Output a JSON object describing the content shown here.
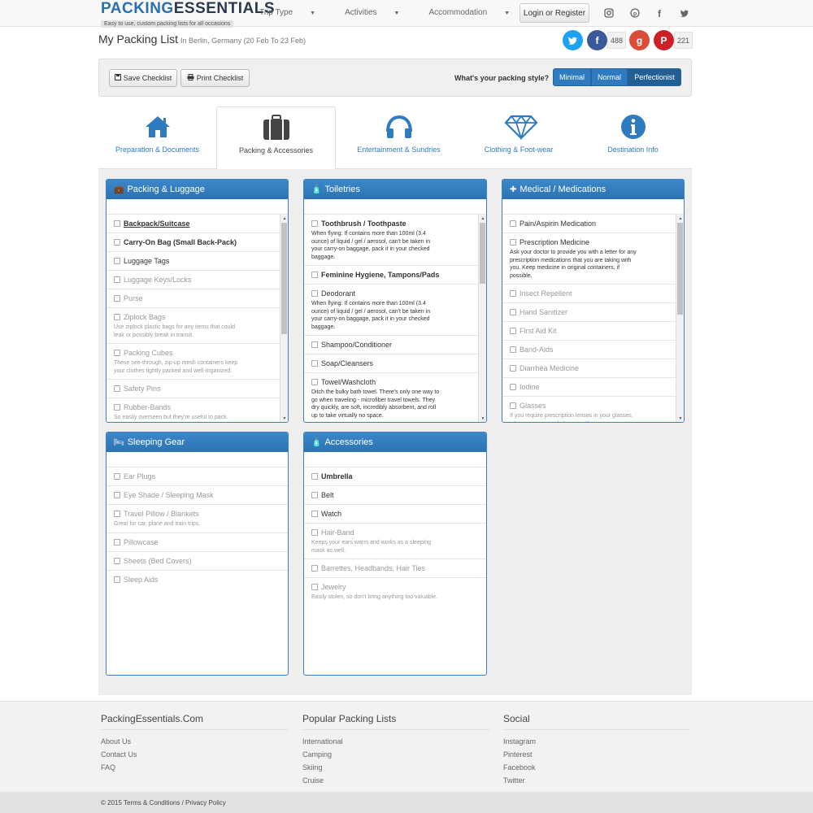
{
  "brand": {
    "logo_text_a": "P",
    "logo_text_b": "ACKING",
    "logo_text_c": "ESSENTIALS",
    "tagline": "Easy to use, custom packing lists for all occasions"
  },
  "nav": {
    "items": [
      {
        "label": "Trip Type",
        "icon": "caret-down-icon"
      },
      {
        "label": "Activities",
        "icon": "caret-down-icon"
      },
      {
        "label": "Accommodation",
        "icon": "caret-down-icon"
      }
    ],
    "login_label": "Login or Register",
    "social_icons": [
      "instagram-icon",
      "pinterest-icon",
      "facebook-icon",
      "twitter-icon"
    ]
  },
  "header": {
    "title": "My Packing List",
    "subtitle": "In Berlin, Germany (20 Feb To 23 Feb)",
    "share": {
      "facebook_count": "488",
      "pinterest_count": "221",
      "colors": {
        "twitter": "#1da1f2",
        "facebook": "#3b5998",
        "google": "#dd4b39",
        "pinterest": "#cb2027"
      }
    }
  },
  "toolbar": {
    "save_label": "Save Checklist",
    "print_label": "Print Checklist",
    "style_question": "What's your packing style?",
    "style_options": [
      "Minimal",
      "Normal",
      "Perfectionist"
    ],
    "style_selected": "Perfectionist"
  },
  "tabs": [
    {
      "label": "Preparation & Documents",
      "icon": "house-icon"
    },
    {
      "label": "Packing & Accessories",
      "icon": "suitcase-icon",
      "active": true
    },
    {
      "label": "Entertainment & Sundries",
      "icon": "headphones-icon"
    },
    {
      "label": "Clothing & Foot-wear",
      "icon": "diamond-icon"
    },
    {
      "label": "Destination Info",
      "icon": "info-icon"
    }
  ],
  "panels": {
    "packing": {
      "title": "Packing & Luggage",
      "icon": "suitcase-icon",
      "items": [
        {
          "name": "Backpack/Suitcase"
        },
        {
          "name": "Carry-On Bag (Small Back-Pack)"
        },
        {
          "name": "Luggage Tags"
        },
        {
          "name": "Luggage Keys/Locks"
        },
        {
          "name": "Purse"
        },
        {
          "name": "Ziplock Bags",
          "desc": "Use ziplock plastic bags for any items that could leak or possibly break in transit."
        },
        {
          "name": "Packing Cubes",
          "desc": "These see-through, zip-up mesh containers keep your clothes tightly packed and well-organized."
        },
        {
          "name": "Safety Pins"
        },
        {
          "name": "Rubber-Bands",
          "desc": "So easily overseen but they're useful to pack."
        }
      ]
    },
    "toiletries": {
      "title": "Toiletries",
      "icon": "bottle-icon",
      "items": [
        {
          "name": "Toothbrush / Toothpaste",
          "desc": "When flying: If contains more than 100ml (3.4 ounce) of liquid / gel / aerosol, can't be taken in your carry-on baggage, pack it in your checked baggage."
        },
        {
          "name": "Feminine Hygiene, Tampons/Pads"
        },
        {
          "name": "Deodorant",
          "desc": "When flying: If contains more than 100ml (3.4 ounce) of liquid / gel / aerosol, can't be taken in your carry-on baggage, pack it in your checked baggage."
        },
        {
          "name": "Shampoo/Conditioner"
        },
        {
          "name": "Soap/Cleansers"
        },
        {
          "name": "Towel/Washcloth",
          "desc": "Ditch the bulky bath towel. There's only one way to go when traveling - microfiber travel towels. They dry quickly, are soft, incredibly absorbent, and roll up to take virtually no space."
        }
      ]
    },
    "medical": {
      "title": "Medical / Medications",
      "icon": "medkit-icon",
      "items": [
        {
          "name": "Pain/Aspirin Medication"
        },
        {
          "name": "Prescription Medicine",
          "desc": "Ask your doctor to provide you with a letter for any prescription medications that you are taking with you. Keep medicine in original containers, if possible."
        },
        {
          "name": "Insect Repellent"
        },
        {
          "name": "Hand Sanitizer"
        },
        {
          "name": "First Aid Kit"
        },
        {
          "name": "Band-Aids"
        },
        {
          "name": "Diarrhea Medicine"
        },
        {
          "name": "Iodine"
        },
        {
          "name": "Glasses",
          "desc": "If you require prescription lenses in your glasses, take a spare pair of glasses with you."
        }
      ]
    },
    "sleeping": {
      "title": "Sleeping Gear",
      "icon": "bed-icon",
      "items": [
        {
          "name": "Ear Plugs"
        },
        {
          "name": "Eye Shade / Sleeping Mask"
        },
        {
          "name": "Travel Pillow / Blankets",
          "desc": "Great for car, plane and train trips."
        },
        {
          "name": "Pillowcase"
        },
        {
          "name": "Sheets (Bed Covers)"
        },
        {
          "name": "Sleep Aids"
        }
      ]
    },
    "accessories": {
      "title": "Accessories",
      "icon": "bottle-icon",
      "items": [
        {
          "name": "Umbrella"
        },
        {
          "name": "Belt"
        },
        {
          "name": "Watch"
        },
        {
          "name": "Hair-Band",
          "desc": "Keeps your ears warm and works as a sleeping mask as well."
        },
        {
          "name": "Barrettes, Headbands, Hair Ties"
        },
        {
          "name": "Jewelry",
          "desc": "Easily stolen, so don't bring anything too valuable."
        }
      ]
    }
  },
  "footer": {
    "columns": [
      {
        "title": "PackingEssentials.Com",
        "links": [
          "About Us",
          "Contact Us",
          "FAQ"
        ]
      },
      {
        "title": "Popular Packing Lists",
        "links": [
          "International",
          "Camping",
          "Skiing",
          "Cruise"
        ]
      },
      {
        "title": "Social",
        "links": [
          "Instagram",
          "Pinterest",
          "Facebook",
          "Twitter"
        ]
      }
    ],
    "copyright": "© 2015 Terms & Conditions / Privacy Policy"
  },
  "colors": {
    "accent": "#2f7bbf",
    "panel_header": "#3180c2",
    "content_bg": "#eeeeee"
  }
}
